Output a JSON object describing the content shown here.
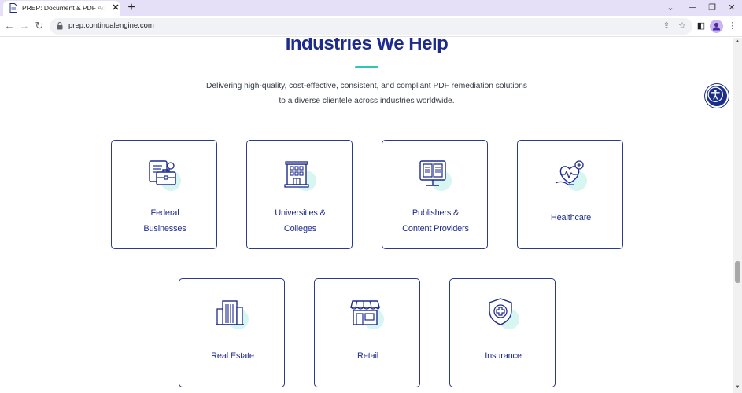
{
  "browser": {
    "tab_title": "PREP: Document & PDF Accessibility",
    "url": "prep.continualengine.com",
    "new_tab_symbol": "+",
    "close_tab_symbol": "✕"
  },
  "page": {
    "heading": "Industries We Help",
    "subtitle_line1": "Delivering high-quality, cost-effective, consistent, and compliant PDF remediation solutions",
    "subtitle_line2": "to a diverse clientele across industries worldwide.",
    "colors": {
      "accent": "#2fc7b3",
      "primary": "#1f2b8c",
      "card_border": "#2a3a8f"
    },
    "industries": [
      {
        "label_line1": "Federal",
        "label_line2": "Businesses",
        "icon": "briefcase-icon"
      },
      {
        "label_line1": "Universities &",
        "label_line2": "Colleges",
        "icon": "university-building-icon"
      },
      {
        "label_line1": "Publishers &",
        "label_line2": "Content Providers",
        "icon": "book-monitor-icon"
      },
      {
        "label_line1": "Healthcare",
        "label_line2": "",
        "icon": "heart-hand-icon"
      },
      {
        "label_line1": "Real Estate",
        "label_line2": "",
        "icon": "office-building-icon"
      },
      {
        "label_line1": "Retail",
        "label_line2": "",
        "icon": "storefront-icon"
      },
      {
        "label_line1": "Insurance",
        "label_line2": "",
        "icon": "shield-cross-icon"
      }
    ]
  }
}
